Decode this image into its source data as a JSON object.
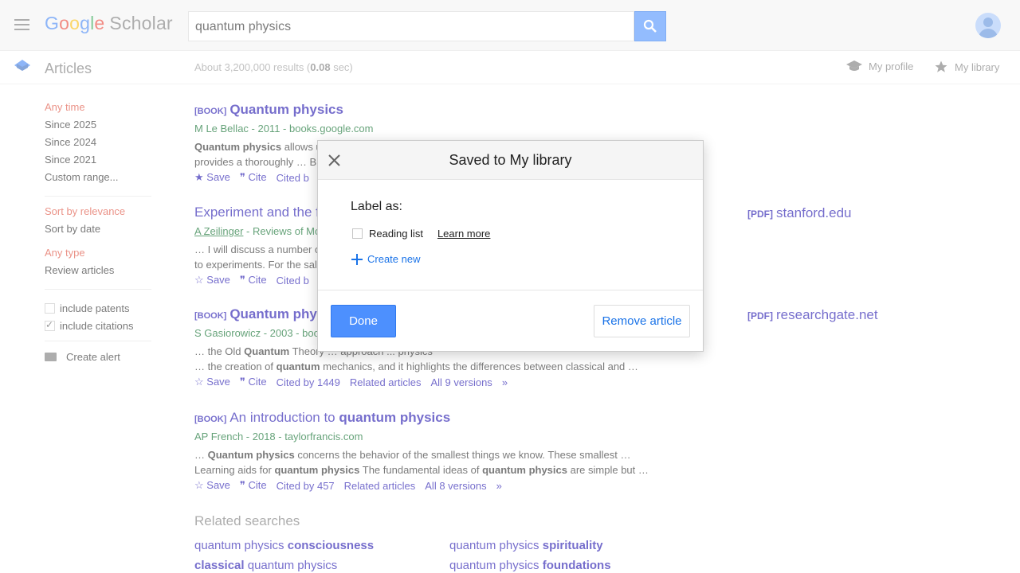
{
  "header": {
    "logo": {
      "g1": "G",
      "g2": "o",
      "g3": "o",
      "g4": "g",
      "g5": "l",
      "g6": "e",
      "scholar": "Scholar"
    },
    "search_value": "quantum physics"
  },
  "subheader": {
    "title": "Articles",
    "results_prefix": "About 3,200,000 results (",
    "results_time": "0.08",
    "results_suffix": " sec)",
    "my_profile": "My profile",
    "my_library": "My library"
  },
  "sidebar": {
    "time": [
      "Any time",
      "Since 2025",
      "Since 2024",
      "Since 2021",
      "Custom range..."
    ],
    "sort": [
      "Sort by relevance",
      "Sort by date"
    ],
    "type": [
      "Any type",
      "Review articles"
    ],
    "include_patents": "include patents",
    "include_citations": "include citations",
    "create_alert": "Create alert"
  },
  "results": [
    {
      "tag": "[BOOK]",
      "title": "Quantum physics",
      "meta": "M Le Bellac - 2011 - books.google.com",
      "snip1_b": "Quantum physics",
      "snip1": " allows us to understand the nature of the ...",
      "snip2": "provides a thoroughly … B",
      "save": "Save",
      "cite": "Cite",
      "cited": "Cited b"
    },
    {
      "title": "Experiment and the f",
      "meta_author": "A Zeilinger",
      "meta_rest": " - Reviews of Mo",
      "snip1": "… I will discuss a number o",
      "snip2": "to experiments. For the sal",
      "save": "Save",
      "cite": "Cite",
      "cited": "Cited b",
      "side_tag": "[PDF]",
      "side": "stanford.edu"
    },
    {
      "tag": "[BOOK]",
      "title": "Quantum phy",
      "meta": "S Gasiorowicz - 2003 - boo",
      "snip1_pre": "… the Old ",
      "snip1_b": "Quantum",
      "snip1": " Theory … approach ... physics",
      "snip2_pre": "… the creation of ",
      "snip2_b": "quantum",
      "snip2": " mechanics, and it highlights the differences between classical and …",
      "save": "Save",
      "cite": "Cite",
      "cited": "Cited by 1449",
      "related": "Related articles",
      "versions": "All 9 versions",
      "side_tag": "[PDF]",
      "side": "researchgate.net"
    },
    {
      "tag": "[BOOK]",
      "title_pre": "An introduction to ",
      "title_b": "quantum physics",
      "meta": "AP French - 2018 - taylorfrancis.com",
      "snip1_pre": "… ",
      "snip1_b": "Quantum physics",
      "snip1": " concerns the behavior of the smallest things we know. These smallest …",
      "snip2_pre": "Learning aids for ",
      "snip2_b": "quantum physics",
      "snip2_mid": " The fundamental ideas of ",
      "snip2_b2": "quantum physics",
      "snip2": " are simple but …",
      "save": "Save",
      "cite": "Cite",
      "cited": "Cited by 457",
      "related": "Related articles",
      "versions": "All 8 versions"
    }
  ],
  "related": {
    "heading": "Related searches",
    "items": [
      {
        "pre": "quantum physics ",
        "b": "consciousness",
        "post": ""
      },
      {
        "pre": "quantum physics ",
        "b": "spirituality",
        "post": ""
      },
      {
        "pre": "",
        "b": "classical",
        "post": " quantum physics"
      },
      {
        "pre": "quantum physics ",
        "b": "foundations",
        "post": ""
      }
    ]
  },
  "modal": {
    "title": "Saved to My library",
    "label_as": "Label as:",
    "reading_list": "Reading list",
    "learn_more": "Learn more",
    "create_new": "Create new",
    "done": "Done",
    "remove": "Remove article"
  },
  "colors": {
    "accent": "#4d90fe",
    "link": "#1a0dab",
    "green": "#006621",
    "red": "#dd4b39"
  }
}
